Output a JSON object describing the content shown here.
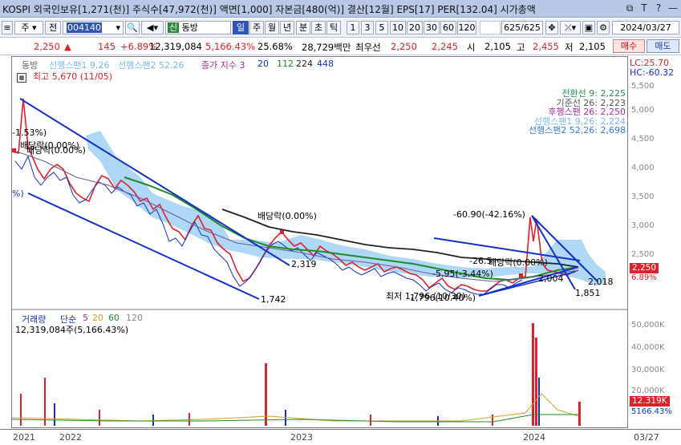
{
  "titlebar": {
    "text": "KOSPI 외국인보유[1,271(천)] 주식수[47,972(천)] 액면[1,000] 자본금[480(억)] 결산[12월] EPS[17] PER[132.04] 시가총액",
    "buttons": [
      "⧉",
      "T",
      "?",
      "—"
    ]
  },
  "toolbar": {
    "period_unit": "주",
    "prefix": "전",
    "code": "004140",
    "badge": "신",
    "name": "동방",
    "intervals": [
      "일",
      "주",
      "월",
      "년",
      "분",
      "초",
      "틱"
    ],
    "selected_interval": "일",
    "ticks": [
      "1",
      "3",
      "5",
      "10",
      "20",
      "30",
      "60",
      "120"
    ],
    "count": "625",
    "count_total": "/625",
    "date": "2024/03/27"
  },
  "quote": {
    "price": "2,250",
    "change_mark": "▲",
    "change": "145",
    "pct": "+6.89%",
    "volume": "12,319,084",
    "vol_pct": "5,166.43%",
    "turnover": "25.68%",
    "amount": "28,729백만",
    "priority_label": "최우선",
    "ask": "2,250",
    "bid": "2,245",
    "open_label": "시",
    "open": "2,105",
    "high_label": "고",
    "high": "2,455",
    "low_label": "저",
    "low": "2,105",
    "buy": "매수",
    "sell": "매도"
  },
  "price_legend": {
    "name": "동방",
    "span1": "선행스팬1 9,26",
    "span2": "선행스팬2 52,26",
    "ma_label": "종가 지수 3",
    "ma_vals": [
      "20",
      "112",
      "224",
      "448"
    ],
    "high_note": "최고 5,670 (11/05)",
    "lc": "LC:25.70",
    "hc": "HC:-60.32"
  },
  "ichimoku_legend": [
    {
      "text": "전환선 9: 2,225",
      "color": "#2a8a5a"
    },
    {
      "text": "기준선 26: 2,223",
      "color": "#555555"
    },
    {
      "text": "후행스팬 26: 2,250",
      "color": "#a0309a"
    },
    {
      "text": "선행스팬1 9,26: 2,224",
      "color": "#7ab8ee"
    },
    {
      "text": "선행스팬2 52,26: 2,698",
      "color": "#3a7ad8"
    }
  ],
  "annotations": {
    "pct_top": "-1.53%)",
    "dividend_top": "배당락(0.00%)",
    "dividend_top2": "배당락(0.00%)",
    "left_pct": "%)",
    "val_2319": "2,319",
    "val_1742": "1,742",
    "dividend_mid": "배당락(0.00%)",
    "drop_pct": "-60.90(-42.16%)",
    "pct_26": "-26.5",
    "dividend_right": "배당락(0.00%)",
    "pct_595": "-5.95(-3.44%)",
    "low_note": "최저 1,796 (10/30)",
    "low_pct": "1,796(10.40%)",
    "val_2018": "2,018",
    "val_1851": "1,851",
    "val_2004": "2,004"
  },
  "price_axis": [
    "5,500",
    "5,000",
    "4,500",
    "4,000",
    "3,500",
    "3,000",
    "2,500"
  ],
  "price_tag": {
    "price": "2,250",
    "pct": "6.89%"
  },
  "volume_legend": {
    "label": "거래량",
    "ma_label": "단순",
    "ma_vals": [
      "5",
      "20",
      "60",
      "120"
    ],
    "value": "12,319,084주(5,166.43%)"
  },
  "volume_axis": [
    "50,000K",
    "40,000K",
    "30,000K",
    "20,000K",
    "10,000K"
  ],
  "volume_tag": {
    "value": "12.319K",
    "pct": "5166.43%"
  },
  "date_axis": [
    "2021",
    "2022",
    "2023",
    "2024",
    "03/27"
  ],
  "colors": {
    "up": "#e0202a",
    "down": "#1530c8",
    "cloud": "#9fd0f3",
    "trend": "#1530c8",
    "ma": "#1f8a2a"
  }
}
